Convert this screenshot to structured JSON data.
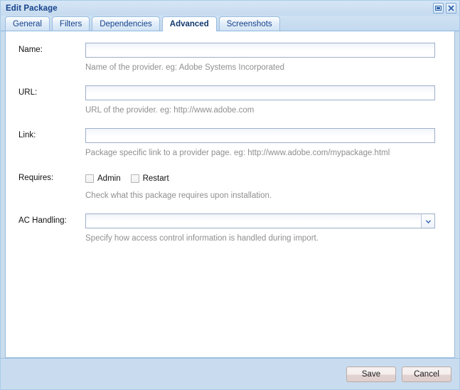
{
  "window": {
    "title": "Edit Package",
    "controls": [
      {
        "name": "restore-button",
        "icon": "restore-icon"
      },
      {
        "name": "close-button",
        "icon": "close-icon"
      }
    ]
  },
  "tabs": [
    {
      "label": "General",
      "active": false
    },
    {
      "label": "Filters",
      "active": false
    },
    {
      "label": "Dependencies",
      "active": false
    },
    {
      "label": "Advanced",
      "active": true
    },
    {
      "label": "Screenshots",
      "active": false
    }
  ],
  "form": {
    "name": {
      "label": "Name:",
      "value": "",
      "placeholder": "",
      "hint": "Name of the provider. eg: Adobe Systems Incorporated"
    },
    "url": {
      "label": "URL:",
      "value": "",
      "placeholder": "",
      "hint": "URL of the provider. eg: http://www.adobe.com"
    },
    "link": {
      "label": "Link:",
      "value": "",
      "placeholder": "",
      "hint": "Package specific link to a provider page. eg: http://www.adobe.com/mypackage.html"
    },
    "requires": {
      "label": "Requires:",
      "hint": "Check what this package requires upon installation.",
      "options": [
        {
          "label": "Admin",
          "checked": false
        },
        {
          "label": "Restart",
          "checked": false
        }
      ]
    },
    "ac_handling": {
      "label": "AC Handling:",
      "value": "",
      "hint": "Specify how access control information is handled during import.",
      "arrow_icon": "chevron-down-icon"
    }
  },
  "footer": {
    "save_label": "Save",
    "cancel_label": "Cancel"
  },
  "colors": {
    "title_text": "#15428b",
    "window_border": "#a8cbe8",
    "tab_border": "#99bbe0",
    "footer_bg": "#c9dcef",
    "hint_text": "#8f8f8f",
    "input_border": "#9eaec9"
  }
}
